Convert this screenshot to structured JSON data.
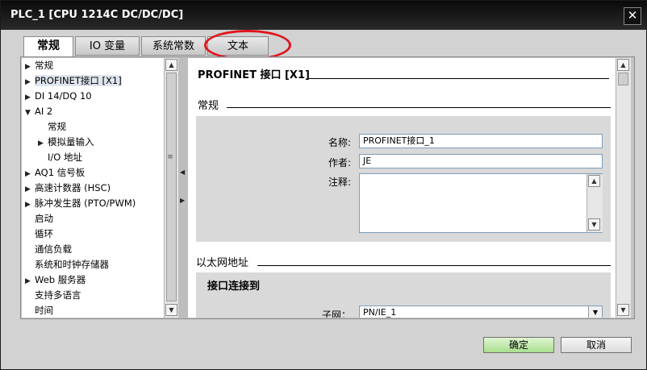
{
  "window": {
    "title": "PLC_1 [CPU 1214C DC/DC/DC]",
    "close": "✕"
  },
  "tabs": [
    {
      "label": "常规"
    },
    {
      "label": "IO 变量"
    },
    {
      "label": "系统常数"
    },
    {
      "label": "文本"
    }
  ],
  "tree": [
    {
      "label": "常规",
      "arrow": "▶",
      "indent": 0
    },
    {
      "label": "PROFINET接口 [X1]",
      "arrow": "▶",
      "indent": 0,
      "selected": true
    },
    {
      "label": "DI 14/DQ 10",
      "arrow": "▶",
      "indent": 0
    },
    {
      "label": "AI 2",
      "arrow": "▼",
      "indent": 0
    },
    {
      "label": "常规",
      "arrow": "",
      "indent": 1
    },
    {
      "label": "模拟量输入",
      "arrow": "▶",
      "indent": 1
    },
    {
      "label": "I/O 地址",
      "arrow": "",
      "indent": 1
    },
    {
      "label": "AQ1 信号板",
      "arrow": "▶",
      "indent": 0
    },
    {
      "label": "高速计数器 (HSC)",
      "arrow": "▶",
      "indent": 0
    },
    {
      "label": "脉冲发生器 (PTO/PWM)",
      "arrow": "▶",
      "indent": 0
    },
    {
      "label": "启动",
      "arrow": "",
      "indent": 0
    },
    {
      "label": "循环",
      "arrow": "",
      "indent": 0
    },
    {
      "label": "通信负载",
      "arrow": "",
      "indent": 0
    },
    {
      "label": "系统和时钟存储器",
      "arrow": "",
      "indent": 0
    },
    {
      "label": "Web 服务器",
      "arrow": "▶",
      "indent": 0
    },
    {
      "label": "支持多语言",
      "arrow": "",
      "indent": 0
    },
    {
      "label": "时间",
      "arrow": "",
      "indent": 0
    }
  ],
  "content": {
    "section_title": "PROFINET 接口 [X1]",
    "general_title": "常规",
    "name_label": "名称:",
    "name_value": "PROFINET接口_1",
    "author_label": "作者:",
    "author_value": "JE",
    "comment_label": "注释:",
    "comment_value": "",
    "ethernet_title": "以太网地址",
    "interface_title": "接口连接到",
    "subnet_label": "子网：",
    "subnet_value": "PN/IE_1"
  },
  "buttons": {
    "ok": "确定",
    "cancel": "取消"
  },
  "colors": {
    "ok_button": "#a9e08e",
    "highlight_ellipse": "#e0141c",
    "titlebar": "#0a0a0a"
  }
}
